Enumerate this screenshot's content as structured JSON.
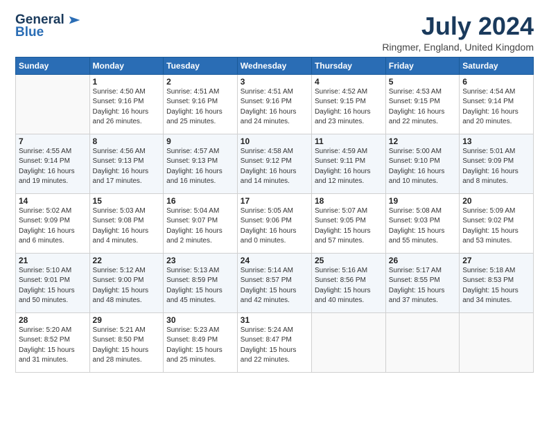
{
  "header": {
    "logo_line1": "General",
    "logo_line2": "Blue",
    "month_year": "July 2024",
    "location": "Ringmer, England, United Kingdom"
  },
  "weekdays": [
    "Sunday",
    "Monday",
    "Tuesday",
    "Wednesday",
    "Thursday",
    "Friday",
    "Saturday"
  ],
  "weeks": [
    [
      {
        "day": "",
        "info": ""
      },
      {
        "day": "1",
        "info": "Sunrise: 4:50 AM\nSunset: 9:16 PM\nDaylight: 16 hours\nand 26 minutes."
      },
      {
        "day": "2",
        "info": "Sunrise: 4:51 AM\nSunset: 9:16 PM\nDaylight: 16 hours\nand 25 minutes."
      },
      {
        "day": "3",
        "info": "Sunrise: 4:51 AM\nSunset: 9:16 PM\nDaylight: 16 hours\nand 24 minutes."
      },
      {
        "day": "4",
        "info": "Sunrise: 4:52 AM\nSunset: 9:15 PM\nDaylight: 16 hours\nand 23 minutes."
      },
      {
        "day": "5",
        "info": "Sunrise: 4:53 AM\nSunset: 9:15 PM\nDaylight: 16 hours\nand 22 minutes."
      },
      {
        "day": "6",
        "info": "Sunrise: 4:54 AM\nSunset: 9:14 PM\nDaylight: 16 hours\nand 20 minutes."
      }
    ],
    [
      {
        "day": "7",
        "info": "Sunrise: 4:55 AM\nSunset: 9:14 PM\nDaylight: 16 hours\nand 19 minutes."
      },
      {
        "day": "8",
        "info": "Sunrise: 4:56 AM\nSunset: 9:13 PM\nDaylight: 16 hours\nand 17 minutes."
      },
      {
        "day": "9",
        "info": "Sunrise: 4:57 AM\nSunset: 9:13 PM\nDaylight: 16 hours\nand 16 minutes."
      },
      {
        "day": "10",
        "info": "Sunrise: 4:58 AM\nSunset: 9:12 PM\nDaylight: 16 hours\nand 14 minutes."
      },
      {
        "day": "11",
        "info": "Sunrise: 4:59 AM\nSunset: 9:11 PM\nDaylight: 16 hours\nand 12 minutes."
      },
      {
        "day": "12",
        "info": "Sunrise: 5:00 AM\nSunset: 9:10 PM\nDaylight: 16 hours\nand 10 minutes."
      },
      {
        "day": "13",
        "info": "Sunrise: 5:01 AM\nSunset: 9:09 PM\nDaylight: 16 hours\nand 8 minutes."
      }
    ],
    [
      {
        "day": "14",
        "info": "Sunrise: 5:02 AM\nSunset: 9:09 PM\nDaylight: 16 hours\nand 6 minutes."
      },
      {
        "day": "15",
        "info": "Sunrise: 5:03 AM\nSunset: 9:08 PM\nDaylight: 16 hours\nand 4 minutes."
      },
      {
        "day": "16",
        "info": "Sunrise: 5:04 AM\nSunset: 9:07 PM\nDaylight: 16 hours\nand 2 minutes."
      },
      {
        "day": "17",
        "info": "Sunrise: 5:05 AM\nSunset: 9:06 PM\nDaylight: 16 hours\nand 0 minutes."
      },
      {
        "day": "18",
        "info": "Sunrise: 5:07 AM\nSunset: 9:05 PM\nDaylight: 15 hours\nand 57 minutes."
      },
      {
        "day": "19",
        "info": "Sunrise: 5:08 AM\nSunset: 9:03 PM\nDaylight: 15 hours\nand 55 minutes."
      },
      {
        "day": "20",
        "info": "Sunrise: 5:09 AM\nSunset: 9:02 PM\nDaylight: 15 hours\nand 53 minutes."
      }
    ],
    [
      {
        "day": "21",
        "info": "Sunrise: 5:10 AM\nSunset: 9:01 PM\nDaylight: 15 hours\nand 50 minutes."
      },
      {
        "day": "22",
        "info": "Sunrise: 5:12 AM\nSunset: 9:00 PM\nDaylight: 15 hours\nand 48 minutes."
      },
      {
        "day": "23",
        "info": "Sunrise: 5:13 AM\nSunset: 8:59 PM\nDaylight: 15 hours\nand 45 minutes."
      },
      {
        "day": "24",
        "info": "Sunrise: 5:14 AM\nSunset: 8:57 PM\nDaylight: 15 hours\nand 42 minutes."
      },
      {
        "day": "25",
        "info": "Sunrise: 5:16 AM\nSunset: 8:56 PM\nDaylight: 15 hours\nand 40 minutes."
      },
      {
        "day": "26",
        "info": "Sunrise: 5:17 AM\nSunset: 8:55 PM\nDaylight: 15 hours\nand 37 minutes."
      },
      {
        "day": "27",
        "info": "Sunrise: 5:18 AM\nSunset: 8:53 PM\nDaylight: 15 hours\nand 34 minutes."
      }
    ],
    [
      {
        "day": "28",
        "info": "Sunrise: 5:20 AM\nSunset: 8:52 PM\nDaylight: 15 hours\nand 31 minutes."
      },
      {
        "day": "29",
        "info": "Sunrise: 5:21 AM\nSunset: 8:50 PM\nDaylight: 15 hours\nand 28 minutes."
      },
      {
        "day": "30",
        "info": "Sunrise: 5:23 AM\nSunset: 8:49 PM\nDaylight: 15 hours\nand 25 minutes."
      },
      {
        "day": "31",
        "info": "Sunrise: 5:24 AM\nSunset: 8:47 PM\nDaylight: 15 hours\nand 22 minutes."
      },
      {
        "day": "",
        "info": ""
      },
      {
        "day": "",
        "info": ""
      },
      {
        "day": "",
        "info": ""
      }
    ]
  ]
}
